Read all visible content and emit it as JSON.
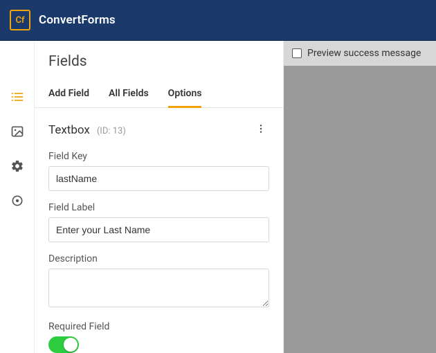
{
  "brand": {
    "logo_text": "Cf",
    "name": "ConvertForms"
  },
  "iconbar": {
    "items": [
      {
        "name": "fields-icon",
        "active": true
      },
      {
        "name": "image-icon",
        "active": false
      },
      {
        "name": "settings-icon",
        "active": false
      },
      {
        "name": "target-icon",
        "active": false
      }
    ]
  },
  "panel": {
    "title": "Fields",
    "tabs": [
      {
        "label": "Add Field",
        "active": false
      },
      {
        "label": "All Fields",
        "active": false
      },
      {
        "label": "Options",
        "active": true
      }
    ]
  },
  "section": {
    "heading": "Textbox",
    "id_text": "(ID: 13)",
    "fields": {
      "key": {
        "label": "Field Key",
        "value": "lastName"
      },
      "label": {
        "label": "Field Label",
        "value": "Enter your Last Name"
      },
      "description": {
        "label": "Description",
        "value": ""
      },
      "required": {
        "label": "Required Field",
        "value": true
      }
    }
  },
  "preview": {
    "checkbox_label": "Preview success message",
    "checked": false
  }
}
